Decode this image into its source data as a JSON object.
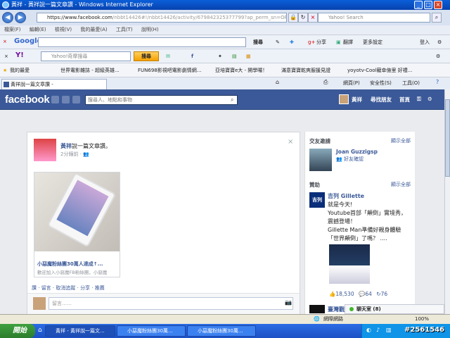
{
  "window": {
    "title": "黃祥 - 黃祥說一篇文章讚 - Windows Internet Explorer"
  },
  "address": {
    "url_main": "https://www.facebook.com",
    "url_rest": "/nbbt14426#!/nbbt14426/activity/679842325377799?ap_perm_sn=OPEN_OR",
    "search_placeholder": "Yahoo! Search"
  },
  "menu": [
    "檔案(F)",
    "編輯(E)",
    "檢視(V)",
    "我的最愛(A)",
    "工具(T)",
    "說明(H)"
  ],
  "google_bar": {
    "logo": "Google",
    "search_btn": "搜尋",
    "share": "分享",
    "translate": "翻譯",
    "more": "更多設定",
    "login": "登入"
  },
  "yahoo_bar": {
    "placeholder": "Yahoo!奇摩搜尋",
    "search_btn": "搜尋"
  },
  "favorites": {
    "label": "我的最愛",
    "items": [
      "世界電影雜誌 - 超級英雄...",
      "FUN698影視吧電影劇情網...",
      "亞培寶寶e大 - 開學囉！",
      "滿意寶寶乾爽服援見證",
      "yoyotv-Cool寵幸億里 好禮..."
    ]
  },
  "tab": {
    "label": "黃祥說一篇文章讚 -"
  },
  "ie_tools": {
    "page": "網頁(P)",
    "safety": "安全性(S)",
    "tools": "工具(O)"
  },
  "fb": {
    "logo": "facebook",
    "search_placeholder": "搜尋人、地點和事物",
    "nav": {
      "user": "黃祥",
      "find": "尋找朋友",
      "home": "首頁"
    },
    "post": {
      "author": "黃祥",
      "action": "說一篇文章讚。",
      "time": "2分鐘前",
      "link_title": "小惡魔粉絲團30萬人達成↑...",
      "link_desc": "歡迎加入小惡魔FB粉絲團，小惡魔",
      "actions": {
        "like": "讚",
        "comment": "留言",
        "unfollow": "取消追蹤",
        "share": "分享",
        "promote": "推薦"
      },
      "comment_placeholder": "留言……"
    },
    "right": {
      "requests_title": "交友邀請",
      "see_all": "顯示全部",
      "friend_name": "Joan Guzzigsp",
      "friend_confirm": "好友確認",
      "sponsored_title": "贊助",
      "ad_see_all": "顯示全部",
      "ad_brand": "吉列 Gillette",
      "ad_logo": "吉列",
      "ad_text": [
        "就是今天!",
        "Youtube首部「顛倒」實境秀，震撼登場！",
        "Gillette Man準備好親身體驗「世界顛倒」了嗎？ ...."
      ],
      "ad_likes": "18,530",
      "ad_comments": "64",
      "ad_shares": "76",
      "next_ad": "臺灣觀"
    },
    "chat": "聊天室 (8)"
  },
  "status": {
    "zone": "網際網路",
    "zoom": "100%"
  },
  "taskbar": {
    "start": "開始",
    "tasks": [
      "黃祥 - 黃祥說一篇文...",
      "小惡魔粉絲團30萬...",
      "小惡魔粉絲團30萬..."
    ],
    "watermark": "#2561546"
  },
  "colors": {
    "fb_blue": "#3b5998",
    "xp_blue": "#245edb",
    "ie_chrome": "#dde6f4"
  }
}
